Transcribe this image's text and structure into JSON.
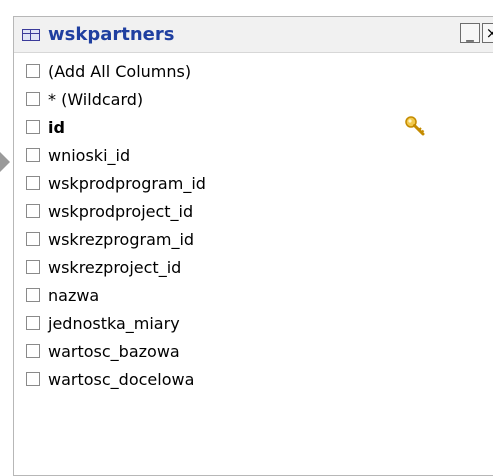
{
  "window": {
    "title": "wskpartners",
    "minimize_glyph": "_",
    "close_glyph": "×"
  },
  "icons": {
    "table": "table-icon",
    "primary_key": "key-icon",
    "row_pointer": "arrow-right-icon"
  },
  "columns": [
    {
      "label": "(Add All Columns)",
      "bold": false,
      "key": false
    },
    {
      "label": "* (Wildcard)",
      "bold": false,
      "key": false
    },
    {
      "label": "id",
      "bold": true,
      "key": true
    },
    {
      "label": "wnioski_id",
      "bold": false,
      "key": false
    },
    {
      "label": "wskprodprogram_id",
      "bold": false,
      "key": false
    },
    {
      "label": "wskprodproject_id",
      "bold": false,
      "key": false
    },
    {
      "label": "wskrezprogram_id",
      "bold": false,
      "key": false
    },
    {
      "label": "wskrezproject_id",
      "bold": false,
      "key": false
    },
    {
      "label": "nazwa",
      "bold": false,
      "key": false
    },
    {
      "label": "jednostka_miary",
      "bold": false,
      "key": false
    },
    {
      "label": "wartosc_bazowa",
      "bold": false,
      "key": false
    },
    {
      "label": "wartosc_docelowa",
      "bold": false,
      "key": false
    }
  ],
  "colors": {
    "title_text": "#1f3fa0",
    "titlebar_bg": "#f1f1f1",
    "key_gold": "#e8b400"
  }
}
